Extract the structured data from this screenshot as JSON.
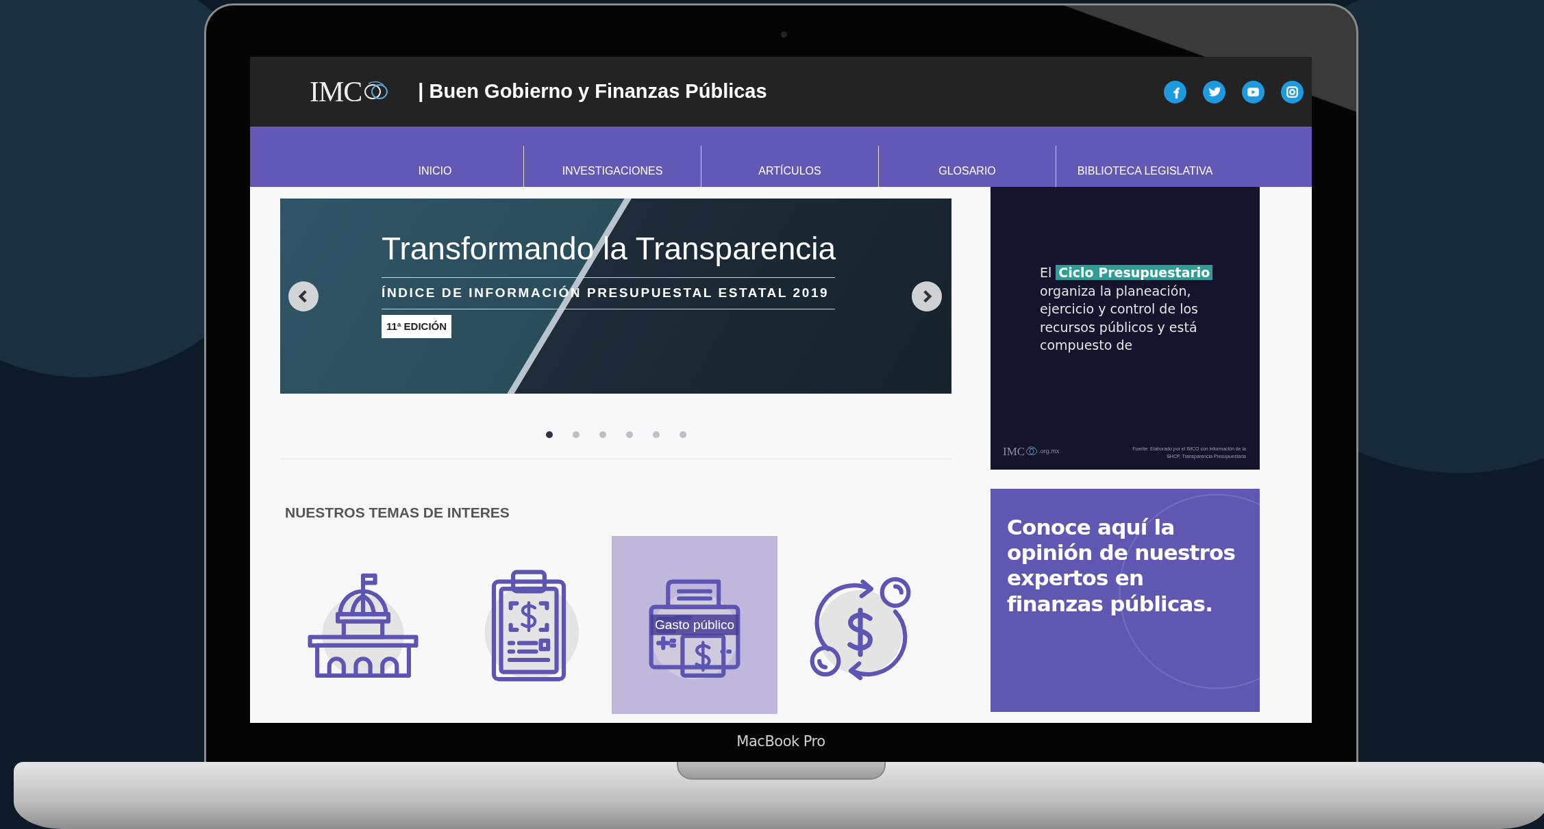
{
  "header": {
    "logo_text": "IMC",
    "title": "| Buen Gobierno y Finanzas Públicas",
    "social": [
      {
        "kind": "facebook"
      },
      {
        "kind": "twitter"
      },
      {
        "kind": "youtube"
      },
      {
        "kind": "instagram"
      }
    ]
  },
  "nav": [
    {
      "label": "INICIO"
    },
    {
      "label": "INVESTIGACIONES"
    },
    {
      "label": "ARTÍCULOS"
    },
    {
      "label": "GLOSARIO"
    },
    {
      "label": "BIBLIOTECA LEGISLATIVA"
    }
  ],
  "banner": {
    "title": "Transformando la Transparencia",
    "subtitle": "ÍNDICE DE INFORMACIÓN PRESUPUESTAL ESTATAL 2019",
    "badge": "11ª EDICIÓN"
  },
  "carousel_dots": [
    {
      "selected": true
    },
    {
      "selected": false
    },
    {
      "selected": false
    },
    {
      "selected": false
    },
    {
      "selected": false
    },
    {
      "selected": false
    }
  ],
  "topics": {
    "heading": "NUESTROS TEMAS DE INTERES",
    "items": [
      {
        "kind": "capitol",
        "selected": false
      },
      {
        "kind": "clipboard",
        "selected": false
      },
      {
        "kind": "register",
        "selected": true,
        "label": "Gasto público"
      },
      {
        "kind": "exchange",
        "selected": false
      }
    ]
  },
  "sidebar": {
    "budget_card": {
      "text": "El **Ciclo Presupuestario** organiza la planeación, ejercicio y control de los recursos públicos y está compuesto de",
      "logo_text": "IMC",
      "logo_suffix": ".org.mx",
      "source": "Fuente: Elaborado por el IMCO con información de la SHCP, Transparencia Presupuestaria"
    },
    "experts_card": {
      "text": "Conoce aquí la opinión de nuestros expertos en finanzas públicas."
    }
  },
  "device": {
    "label": "MacBook Pro"
  }
}
